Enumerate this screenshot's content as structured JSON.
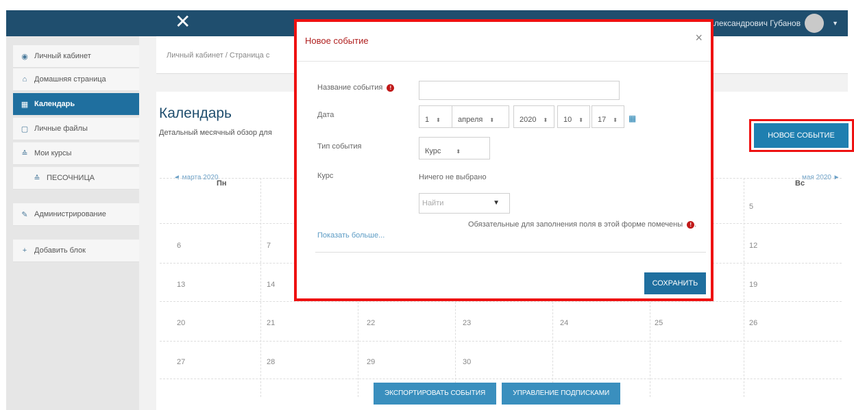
{
  "topbar": {
    "close_glyph": "✕",
    "user_name": "Александрович Губанов",
    "caret": "▼"
  },
  "sidebar": {
    "items": [
      {
        "label": "Личный кабинет",
        "icon": "dashboard-icon",
        "glyph": "◉"
      },
      {
        "label": "Домашняя страница",
        "icon": "home-icon",
        "glyph": "⌂"
      },
      {
        "label": "Календарь",
        "icon": "calendar-icon",
        "glyph": "▦"
      },
      {
        "label": "Личные файлы",
        "icon": "file-icon",
        "glyph": "▢"
      },
      {
        "label": "Мои курсы",
        "icon": "graduation-cap-icon",
        "glyph": "≙"
      },
      {
        "label": "ПЕСОЧНИЦА",
        "icon": "graduation-cap-icon",
        "glyph": "≙"
      },
      {
        "label": "Администрирование",
        "icon": "wrench-icon",
        "glyph": "✎"
      },
      {
        "label": "Добавить блок",
        "icon": "plus-square-icon",
        "glyph": "+"
      }
    ]
  },
  "breadcrumb": "Личный кабинет / Страница с",
  "calendar": {
    "title": "Календарь",
    "description": "Детальный месячный обзор для",
    "prev_month": "◄ марта 2020",
    "next_month": "мая 2020 ►",
    "new_event_button": "НОВОЕ СОБЫТИЕ",
    "weekdays": [
      "Пн",
      "Вс"
    ],
    "days": [
      "5",
      "6",
      "7",
      "12",
      "13",
      "14",
      "19",
      "20",
      "21",
      "22",
      "23",
      "24",
      "25",
      "26",
      "27",
      "28",
      "29",
      "30"
    ]
  },
  "footer": {
    "export_button": "ЭКСПОРТИРОВАТЬ СОБЫТИЯ",
    "subscriptions_button": "УПРАВЛЕНИЕ ПОДПИСКАМИ"
  },
  "modal": {
    "title": "Новое событие",
    "close_glyph": "×",
    "fields": {
      "name_label": "Название события",
      "date_label": "Дата",
      "type_label": "Тип события",
      "course_label": "Курс"
    },
    "date": {
      "day": "1",
      "month": "апреля",
      "year": "2020",
      "hour": "10",
      "minute": "17"
    },
    "arrow_glyph": "⬍",
    "event_type_value": "Курс",
    "course_value": "Ничего не выбрано",
    "search_placeholder": "Найти",
    "search_arrow": "▼",
    "required_note": "Обязательные для заполнения поля в этой форме помечены",
    "required_glyph": "!",
    "show_more": "Показать больше...",
    "save_button": "СОХРАНИТЬ",
    "calendar_glyph": "▦"
  },
  "colors": {
    "navbar": "#1f4e6e",
    "accent": "#1f7fb0",
    "highlight": "#ee1111",
    "required": "#c01919"
  }
}
